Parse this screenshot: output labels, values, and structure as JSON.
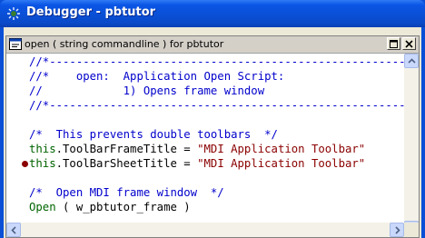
{
  "window": {
    "title": "Debugger - pbtutor"
  },
  "child": {
    "title": "open ( string commandline ) for pbtutor"
  },
  "code_lines": [
    {
      "text": "//*-----------------------------------------------------------",
      "kind": "comment",
      "breakpoint": false
    },
    {
      "text": "//*    open:  Application Open Script:",
      "kind": "comment",
      "breakpoint": false
    },
    {
      "text": "//            1) Opens frame window",
      "kind": "comment",
      "breakpoint": false
    },
    {
      "text": "//*-----------------------------------------------------------",
      "kind": "comment",
      "breakpoint": false
    },
    {
      "text": "",
      "kind": "blank",
      "breakpoint": false
    },
    {
      "text": "/*  This prevents double toolbars  */",
      "kind": "comment",
      "breakpoint": false
    },
    {
      "parts": [
        {
          "t": "this",
          "k": "keyword"
        },
        {
          "t": ".ToolBarFrameTitle = ",
          "k": "plain"
        },
        {
          "t": "\"MDI Application Toolbar\"",
          "k": "string"
        }
      ],
      "breakpoint": false
    },
    {
      "parts": [
        {
          "t": "this",
          "k": "keyword"
        },
        {
          "t": ".ToolBarSheetTitle = ",
          "k": "plain"
        },
        {
          "t": "\"MDI Application Toolbar\"",
          "k": "string"
        }
      ],
      "breakpoint": true
    },
    {
      "text": "",
      "kind": "blank",
      "breakpoint": false
    },
    {
      "text": "/*  Open MDI frame window  */",
      "kind": "comment",
      "breakpoint": false
    },
    {
      "parts": [
        {
          "t": "Open",
          "k": "keyword"
        },
        {
          "t": " ( w_pbtutor_frame )",
          "k": "plain"
        }
      ],
      "breakpoint": false
    }
  ],
  "colors": {
    "comment": "#0000cc",
    "keyword": "#006400",
    "string": "#8b0000",
    "plain": "#000000",
    "breakpoint": "#8b0000"
  }
}
